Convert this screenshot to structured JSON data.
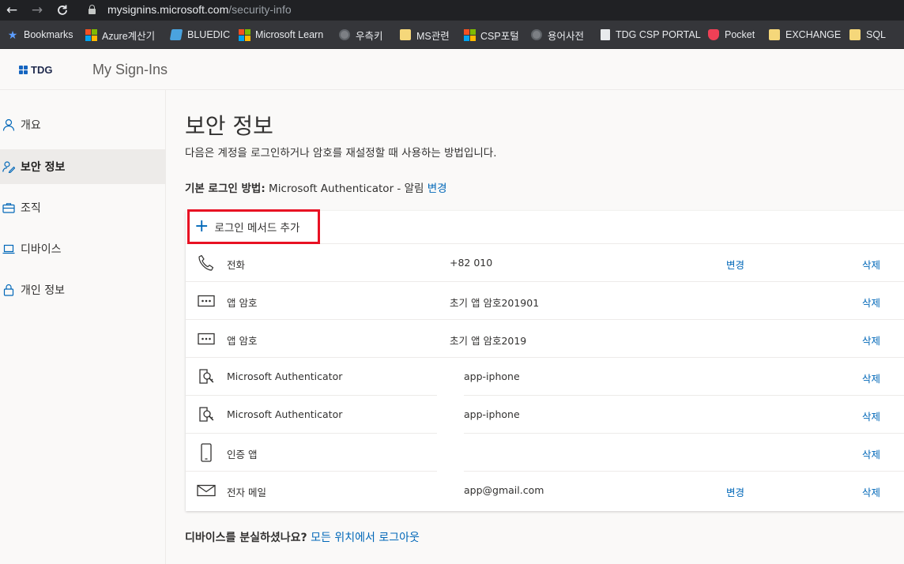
{
  "browser": {
    "url_host": "mysignins.microsoft.com",
    "url_path": "/security-info",
    "bookmarks": [
      {
        "label": "Bookmarks",
        "icon": "star-icon"
      },
      {
        "label": "Azure계산기",
        "icon": "microsoft-logo-icon"
      },
      {
        "label": "BLUEDIC",
        "icon": "bluedic-icon"
      },
      {
        "label": "Microsoft Learn",
        "icon": "microsoft-logo-icon"
      },
      {
        "label": "우측키",
        "icon": "globe-icon"
      },
      {
        "label": "MS관련",
        "icon": "folder-icon"
      },
      {
        "label": "CSP포털",
        "icon": "microsoft-logo-icon"
      },
      {
        "label": "용어사전",
        "icon": "globe-icon"
      },
      {
        "label": "TDG CSP PORTAL",
        "icon": "page-icon"
      },
      {
        "label": "Pocket",
        "icon": "pocket-icon"
      },
      {
        "label": "EXCHANGE",
        "icon": "folder-icon"
      },
      {
        "label": "SQL",
        "icon": "folder-icon"
      }
    ]
  },
  "header": {
    "logo_text": "TDG",
    "app_title": "My Sign-Ins"
  },
  "sidebar": {
    "items": [
      {
        "label": "개요",
        "icon": "person-icon",
        "active": false
      },
      {
        "label": "보안 정보",
        "icon": "security-info-icon",
        "active": true
      },
      {
        "label": "조직",
        "icon": "briefcase-icon",
        "active": false
      },
      {
        "label": "디바이스",
        "icon": "laptop-icon",
        "active": false
      },
      {
        "label": "개인 정보",
        "icon": "lock-icon",
        "active": false
      }
    ]
  },
  "main": {
    "title": "보안 정보",
    "description": "다음은 계정을 로그인하거나 암호를 재설정할 때 사용하는 방법입니다.",
    "default_label": "기본 로그인 방법:",
    "default_value": "Microsoft Authenticator - 알림",
    "default_change": "변경",
    "add_method_label": "로그인 메서드 추가",
    "methods": [
      {
        "name": "전화",
        "icon": "phone-icon",
        "detail": "+82 010",
        "change": "변경",
        "delete": "삭제"
      },
      {
        "name": "앱 암호",
        "icon": "app-password-icon",
        "detail": "초기 앱 암호201901",
        "change": "",
        "delete": "삭제"
      },
      {
        "name": "앱 암호",
        "icon": "app-password-icon",
        "detail": "초기 앱 암호2019",
        "change": "",
        "delete": "삭제"
      },
      {
        "name": "Microsoft Authenticator",
        "icon": "authenticator-icon",
        "detail": "app-iphone",
        "change": "",
        "delete": "삭제"
      },
      {
        "name": "Microsoft Authenticator",
        "icon": "authenticator-icon",
        "detail": "app-iphone",
        "change": "",
        "delete": "삭제"
      },
      {
        "name": "인증 앱",
        "icon": "mobile-phone-icon",
        "detail": "",
        "change": "",
        "delete": "삭제"
      },
      {
        "name": "전자 메일",
        "icon": "mail-icon",
        "detail": "app@gmail.com",
        "change": "변경",
        "delete": "삭제"
      }
    ],
    "lost_device_label": "디바이스를 분실하셨나요?",
    "lost_device_link": "모든 위치에서 로그아웃"
  }
}
